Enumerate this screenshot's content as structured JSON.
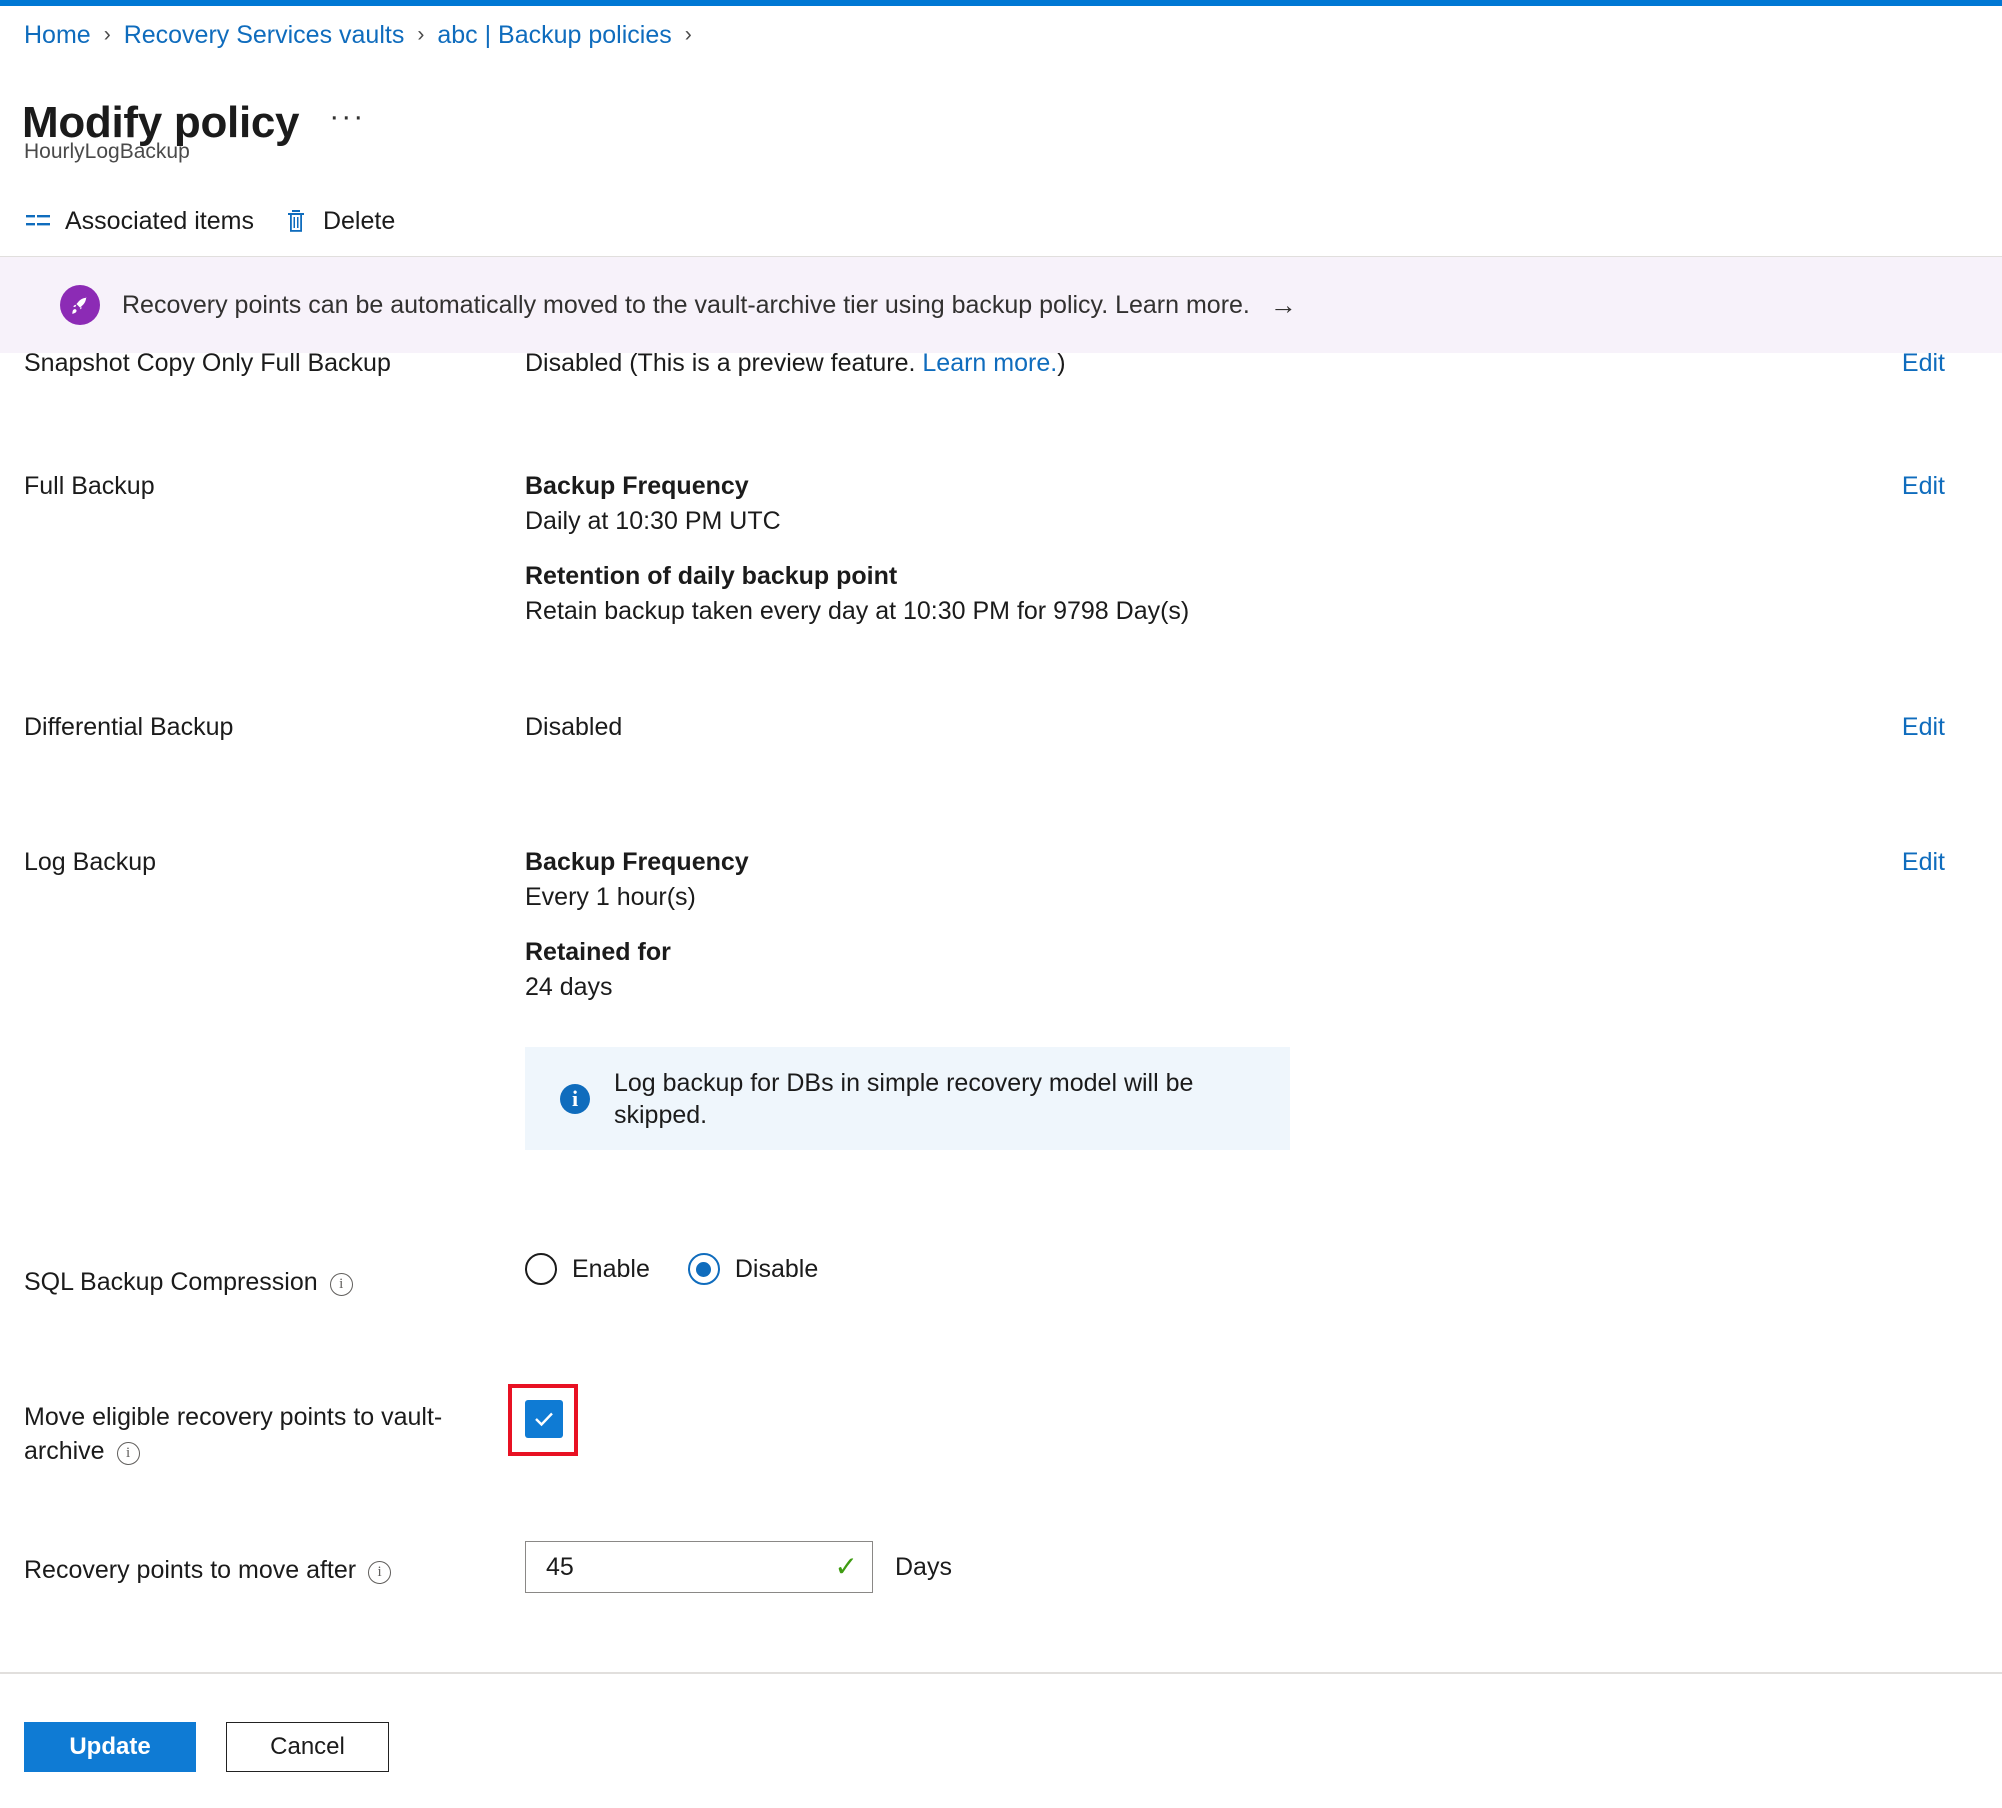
{
  "breadcrumb": {
    "items": [
      {
        "label": "Home"
      },
      {
        "label": "Recovery Services vaults"
      },
      {
        "label": "abc | Backup policies"
      }
    ],
    "separator": "›"
  },
  "header": {
    "title": "Modify policy",
    "more_label": "···",
    "subtitle": "HourlyLogBackup"
  },
  "command_bar": {
    "associated_items": "Associated items",
    "delete": "Delete"
  },
  "promo_banner": {
    "icon": "rocket-icon",
    "text": "Recovery points can be automatically moved to the vault-archive tier using backup policy. Learn more.",
    "arrow": "→",
    "background": "#f7f2fa",
    "icon_color": "#8c2bb5"
  },
  "rows": {
    "snapshot_copy": {
      "label": "Snapshot Copy Only Full Backup",
      "value_prefix": "Disabled (This is a preview feature. ",
      "value_link": "Learn more.",
      "value_suffix": ")",
      "edit": "Edit"
    },
    "full_backup": {
      "label": "Full Backup",
      "frequency_heading": "Backup Frequency",
      "frequency_value": "Daily at 10:30 PM UTC",
      "retention_heading": "Retention of daily backup point",
      "retention_value": "Retain backup taken every day at 10:30 PM for 9798 Day(s)",
      "edit": "Edit"
    },
    "differential_backup": {
      "label": "Differential Backup",
      "value": "Disabled",
      "edit": "Edit"
    },
    "log_backup": {
      "label": "Log Backup",
      "frequency_heading": "Backup Frequency",
      "frequency_value": "Every 1 hour(s)",
      "retained_heading": "Retained for",
      "retained_value": "24 days",
      "edit": "Edit"
    }
  },
  "info_box": {
    "icon": "info-icon",
    "text": "Log backup for DBs in simple recovery model will be skipped.",
    "background": "#eff6fc"
  },
  "sql_compression": {
    "label": "SQL Backup Compression",
    "info_icon": "info-circle-icon",
    "options": [
      {
        "label": "Enable",
        "selected": false
      },
      {
        "label": "Disable",
        "selected": true
      }
    ]
  },
  "vault_archive": {
    "label": "Move eligible recovery points to vault-archive",
    "info_icon": "info-circle-icon",
    "checked": true,
    "checkbox_color": "#0f7bd4",
    "highlight_color": "#e81123"
  },
  "move_after": {
    "label": "Recovery points to move after",
    "info_icon": "info-circle-icon",
    "value": "45",
    "placeholder": "",
    "validation_icon": "check-icon",
    "validation_color": "#3f9c12",
    "unit": "Days"
  },
  "footer": {
    "update": "Update",
    "cancel": "Cancel",
    "primary_color": "#0f7bd4"
  }
}
